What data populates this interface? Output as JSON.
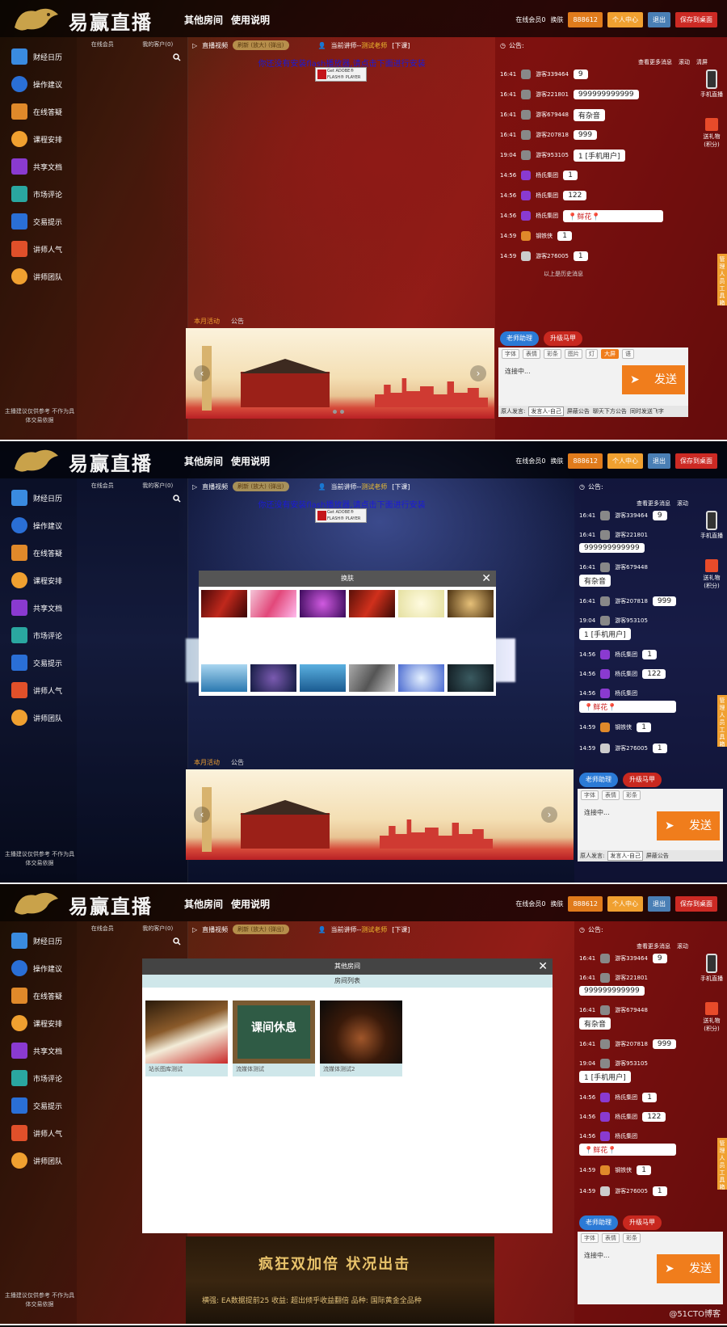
{
  "brand": {
    "name": "易赢直播"
  },
  "nav": [
    "其他房间",
    "使用说明"
  ],
  "header_right": {
    "online": "在线会员0",
    "skin": "换肤",
    "code": "888612",
    "personal_center": "个人中心",
    "logout": "退出",
    "save_desktop": "保存到桌面"
  },
  "sidebar": {
    "items": [
      {
        "label": "财经日历",
        "color": "#3a8be0"
      },
      {
        "label": "操作建议",
        "color": "#2a6fd6"
      },
      {
        "label": "在线答疑",
        "color": "#e0892a"
      },
      {
        "label": "课程安排",
        "color": "#f0a030"
      },
      {
        "label": "共享文档",
        "color": "#8a3ad0"
      },
      {
        "label": "市场评论",
        "color": "#2aa7a0"
      },
      {
        "label": "交易提示",
        "color": "#2a6fd6"
      },
      {
        "label": "讲师人气",
        "color": "#e0502a"
      },
      {
        "label": "讲师团队",
        "color": "#f0a030"
      }
    ],
    "note": "主播建议仅供参考 不作为具体交易依据"
  },
  "members": {
    "tab_online": "在线会员",
    "tab_my": "我的客户(0)"
  },
  "video": {
    "label": "直播视频",
    "tag": "刷新 (放大) (弹出)",
    "lecturer_prefix": "当前讲师--",
    "lecturer": "测试老师",
    "status": "[下课]",
    "flash_msg": "你还没有安装flash播放器,请点击下面进行安装",
    "flash_label": "Get ADOBE® FLASH® PLAYER"
  },
  "promo": {
    "tab_active": "本月活动",
    "tab_notice": "公告"
  },
  "chat": {
    "notice_label": "公告:",
    "more": "查看更多消息",
    "scroll": "滚动",
    "clear": "清屏",
    "history": "以上是历史消息",
    "messages": [
      {
        "time": "16:41",
        "user": "游客339464",
        "text": "9",
        "icon_color": "#888"
      },
      {
        "time": "16:41",
        "user": "游客221801",
        "text": "999999999999",
        "icon_color": "#888"
      },
      {
        "time": "16:41",
        "user": "游客679448",
        "text": "有杂音",
        "icon_color": "#888"
      },
      {
        "time": "16:41",
        "user": "游客207818",
        "text": "999",
        "icon_color": "#888"
      },
      {
        "time": "19:04",
        "user": "游客953105",
        "text": "1 [手机用户]",
        "icon_color": "#888"
      },
      {
        "time": "14:56",
        "user": "杨氏集团",
        "text": "1",
        "icon_color": "#8a3ad0"
      },
      {
        "time": "14:56",
        "user": "杨氏集团",
        "text": "122",
        "icon_color": "#8a3ad0"
      },
      {
        "time": "14:56",
        "user": "杨氏集团",
        "text": "📍鲜花📍",
        "icon_color": "#8a3ad0"
      },
      {
        "time": "14:59",
        "user": "钢铁侠",
        "text": "1",
        "icon_color": "#e0892a"
      },
      {
        "time": "14:59",
        "user": "游客276005",
        "text": "1",
        "icon_color": "#ccc"
      }
    ],
    "phone_live": "手机直播",
    "gift": "送礼物(积分)",
    "strip": "管理人员工具箱",
    "btn_teacher": "老师助理",
    "btn_upgrade": "升级马甲",
    "tools": [
      "字体",
      "表情",
      "彩条",
      "图片",
      "灯",
      "大屏",
      "语"
    ],
    "input_text": "连接中...",
    "send": "发送",
    "footer": [
      "原人发言:",
      "发言人-自己",
      "屏蔽公告",
      "聊天下方公告",
      "同时发送飞字"
    ]
  },
  "skin_modal": {
    "title": "换肤"
  },
  "rooms_modal": {
    "title": "其他房间",
    "subtitle": "房间列表",
    "rooms": [
      {
        "name": "站长图库测试"
      },
      {
        "name": "流媒体测试",
        "board_text": "课间休息"
      },
      {
        "name": "流媒体测试2"
      }
    ]
  },
  "promo_dark": {
    "headline": "疯狂双加倍 状况出击",
    "sub": "横强: EA数据提前25 收益: 超出倾乎收益翻倍 品种: 国际黄金全品种"
  },
  "watermark": "@51CTO博客"
}
